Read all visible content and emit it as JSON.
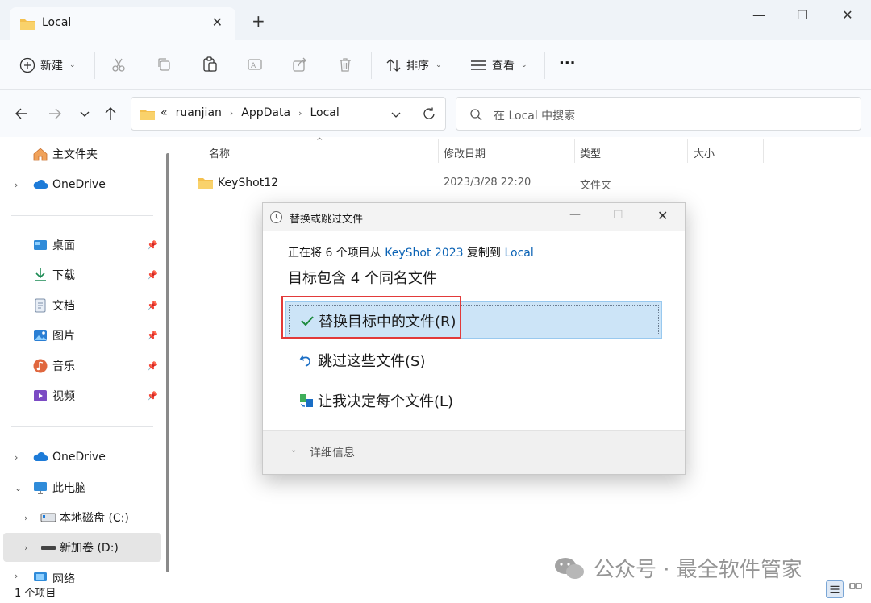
{
  "window": {
    "tab_title": "Local",
    "tab_close": "✕",
    "new_tab": "+",
    "minimize": "—",
    "maximize": "☐",
    "close": "✕"
  },
  "toolbar": {
    "new_label": "新建",
    "sort_label": "排序",
    "view_label": "查看",
    "more_label": "···"
  },
  "address": {
    "crumbs": [
      "«",
      "ruanjian",
      "›",
      "AppData",
      "›",
      "Local"
    ],
    "search_placeholder": "在 Local 中搜索"
  },
  "sidebar": {
    "home": "主文件夹",
    "onedrive_top": "OneDrive",
    "quick": [
      {
        "label": "桌面"
      },
      {
        "label": "下载"
      },
      {
        "label": "文档"
      },
      {
        "label": "图片"
      },
      {
        "label": "音乐"
      },
      {
        "label": "视频"
      }
    ],
    "onedrive": "OneDrive",
    "this_pc": "此电脑",
    "drive_c": "本地磁盘 (C:)",
    "drive_d": "新加卷 (D:)",
    "network": "网络"
  },
  "filelist": {
    "columns": {
      "name": "名称",
      "modified": "修改日期",
      "type": "类型",
      "size": "大小"
    },
    "rows": [
      {
        "name": "KeyShot12",
        "modified": "2023/3/28 22:20",
        "type": "文件夹",
        "size": ""
      }
    ]
  },
  "status": {
    "count": "1 个项目"
  },
  "dialog": {
    "title": "替换或跳过文件",
    "copy_prefix": "正在将 6 个项目从 ",
    "copy_source": "KeyShot 2023",
    "copy_mid": " 复制到 ",
    "copy_dest": "Local",
    "heading": "目标包含 4 个同名文件",
    "options": [
      {
        "label": "替换目标中的文件(R)"
      },
      {
        "label": "跳过这些文件(S)"
      },
      {
        "label": "让我决定每个文件(L)"
      }
    ],
    "details": "详细信息"
  },
  "watermark": {
    "text": "公众号 · 最全软件管家"
  },
  "colors": {
    "accent": "#0b63b5",
    "selection": "#cce4f7",
    "highlight_box": "#e23a3a",
    "folder": "#f4c04e"
  }
}
